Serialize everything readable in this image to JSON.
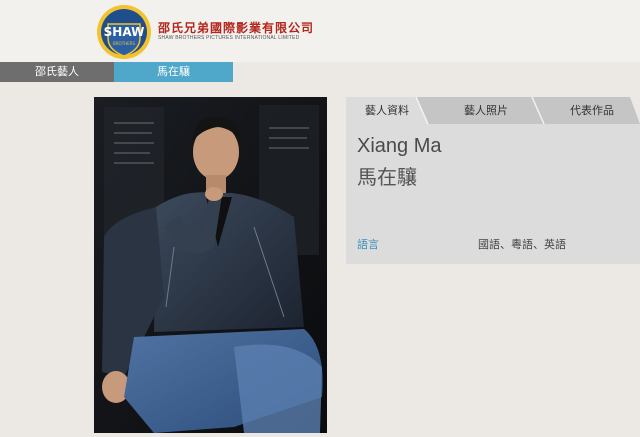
{
  "header": {
    "logo_text": "SHAW",
    "logo_subtext": "BROTHERS",
    "company_cn": "邵氏兄弟國際影業有限公司",
    "company_en": "SHAW BROTHERS PICTURES INTERNATIONAL LIMITED"
  },
  "nav": {
    "items": [
      {
        "label": "邵氏藝人"
      },
      {
        "label": "馬在驤"
      }
    ]
  },
  "tabs": [
    {
      "label": "藝人資料"
    },
    {
      "label": "藝人照片"
    },
    {
      "label": "代表作品"
    }
  ],
  "profile": {
    "name_en": "Xiang Ma",
    "name_cn": "馬在驤",
    "language_label": "語言",
    "language_value": "國語、粵語、英語"
  },
  "colors": {
    "accent": "#4fa7c9",
    "brand_red": "#b3261e",
    "nav_gray": "#6e6e6e",
    "panel": "#dcdcdc"
  }
}
